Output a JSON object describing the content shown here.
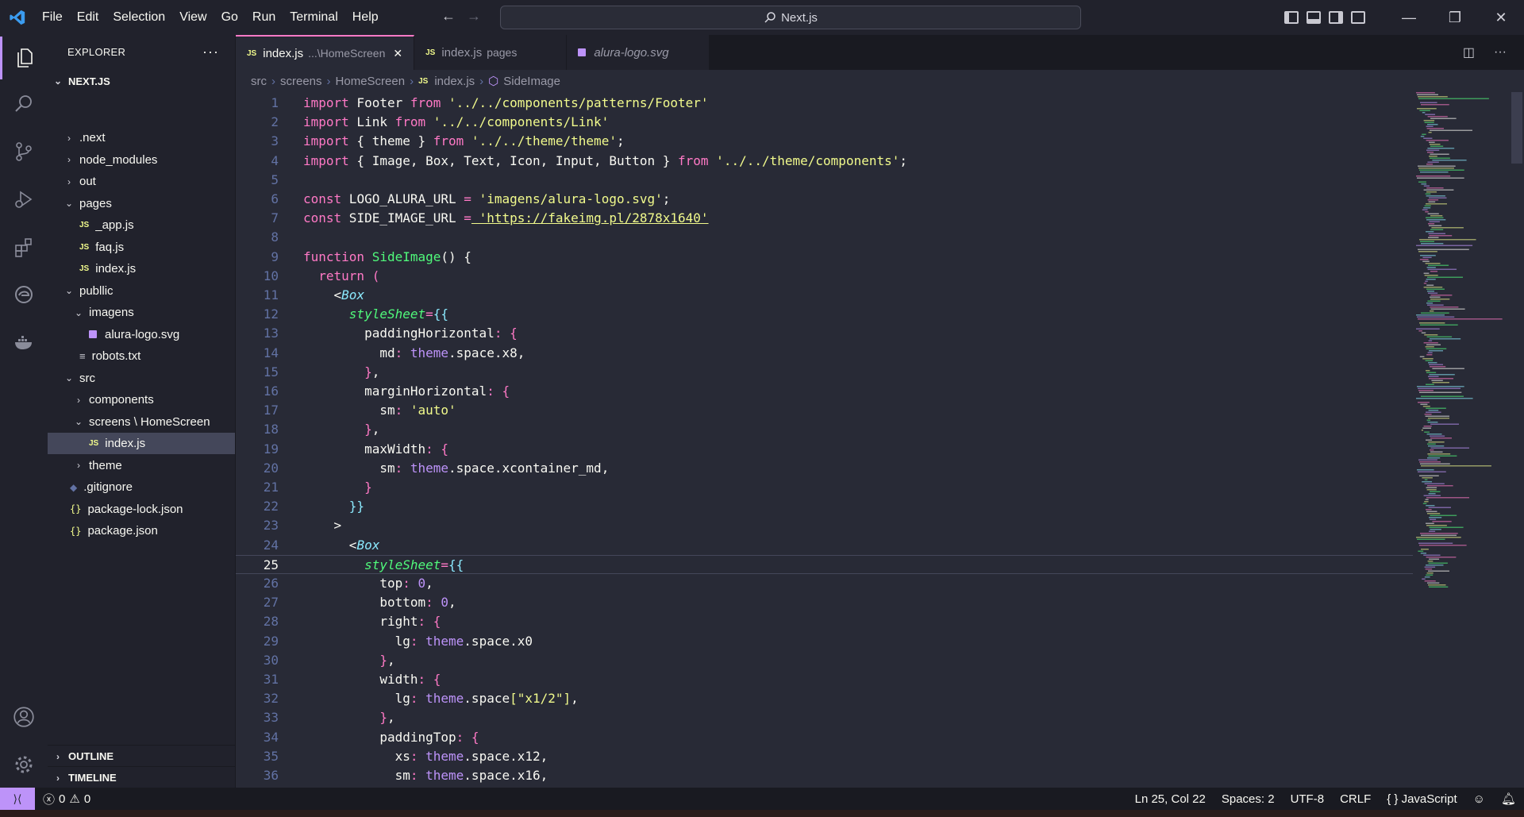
{
  "menu": [
    "File",
    "Edit",
    "Selection",
    "View",
    "Go",
    "Run",
    "Terminal",
    "Help"
  ],
  "command_center": "Next.js",
  "sidebar": {
    "title": "EXPLORER",
    "project": "NEXT.JS",
    "tree": [
      {
        "label": ".next",
        "type": "folder",
        "open": false,
        "depth": 1
      },
      {
        "label": "node_modules",
        "type": "folder",
        "open": false,
        "depth": 1
      },
      {
        "label": "out",
        "type": "folder",
        "open": false,
        "depth": 1
      },
      {
        "label": "pages",
        "type": "folder",
        "open": true,
        "depth": 1
      },
      {
        "label": "_app.js",
        "type": "js",
        "depth": 2
      },
      {
        "label": "faq.js",
        "type": "js",
        "depth": 2
      },
      {
        "label": "index.js",
        "type": "js",
        "depth": 2
      },
      {
        "label": "publlic",
        "type": "folder",
        "open": true,
        "depth": 1
      },
      {
        "label": "imagens",
        "type": "folder",
        "open": true,
        "depth": 2
      },
      {
        "label": "alura-logo.svg",
        "type": "svg",
        "depth": 3
      },
      {
        "label": "robots.txt",
        "type": "txt",
        "depth": 2
      },
      {
        "label": "src",
        "type": "folder",
        "open": true,
        "depth": 1
      },
      {
        "label": "components",
        "type": "folder",
        "open": false,
        "depth": 2
      },
      {
        "label": "screens \\ HomeScreen",
        "type": "folder",
        "open": true,
        "depth": 2
      },
      {
        "label": "index.js",
        "type": "js",
        "depth": 3,
        "selected": true
      },
      {
        "label": "theme",
        "type": "folder",
        "open": false,
        "depth": 2
      },
      {
        "label": ".gitignore",
        "type": "git",
        "depth": 1
      },
      {
        "label": "package-lock.json",
        "type": "json",
        "depth": 1
      },
      {
        "label": "package.json",
        "type": "json",
        "depth": 1
      }
    ],
    "outline": "OUTLINE",
    "timeline": "TIMELINE"
  },
  "tabs": [
    {
      "label": "index.js",
      "desc": "...\\HomeScreen",
      "active": true
    },
    {
      "label": "index.js",
      "desc": "pages",
      "active": false
    },
    {
      "label": "alura-logo.svg",
      "desc": "",
      "active": false
    }
  ],
  "breadcrumb": [
    "src",
    "screens",
    "HomeScreen",
    "index.js",
    "SideImage"
  ],
  "status": {
    "errors": "0",
    "warnings": "0",
    "position": "Ln 25, Col 22",
    "spaces": "Spaces: 2",
    "encoding": "UTF-8",
    "eol": "CRLF",
    "language": "JavaScript"
  },
  "colors": {
    "accent": "#bd93f9",
    "tab_border": "#ff79c6",
    "bg": "#282a36",
    "sidebar": "#21222c"
  },
  "current_line": 25,
  "code": [
    [
      [
        "kw",
        "import"
      ],
      [
        "pun",
        " Footer "
      ],
      [
        "kw",
        "from"
      ],
      [
        "str",
        " '../../components/patterns/Footer'"
      ]
    ],
    [
      [
        "kw",
        "import"
      ],
      [
        "pun",
        " Link "
      ],
      [
        "kw",
        "from"
      ],
      [
        "str",
        " '../../components/Link'"
      ]
    ],
    [
      [
        "kw",
        "import"
      ],
      [
        "pun",
        " { theme } "
      ],
      [
        "kw",
        "from"
      ],
      [
        "str",
        " '../../theme/theme'"
      ],
      [
        "pun",
        ";"
      ]
    ],
    [
      [
        "kw",
        "import"
      ],
      [
        "pun",
        " { Image, Box, Text, Icon, Input, Button } "
      ],
      [
        "kw",
        "from"
      ],
      [
        "str",
        " '../../theme/components'"
      ],
      [
        "pun",
        ";"
      ]
    ],
    [],
    [
      [
        "kw",
        "const"
      ],
      [
        "pun",
        " LOGO_ALURA_URL "
      ],
      [
        "kw",
        "="
      ],
      [
        "str",
        " 'imagens/alura-logo.svg'"
      ],
      [
        "pun",
        ";"
      ]
    ],
    [
      [
        "kw",
        "const"
      ],
      [
        "pun",
        " SIDE_IMAGE_URL "
      ],
      [
        "kw",
        "="
      ],
      [
        "str",
        " 'https://fakeimg.pl/2878x1640'"
      ]
    ],
    [],
    [
      [
        "kw",
        "function"
      ],
      [
        "fn",
        " SideImage"
      ],
      [
        "pun",
        "() {"
      ]
    ],
    [
      [
        "pun",
        "  "
      ],
      [
        "kw",
        "return"
      ],
      [
        "br2",
        " ("
      ]
    ],
    [
      [
        "pun",
        "    <"
      ],
      [
        "comp",
        "Box"
      ]
    ],
    [
      [
        "pun",
        "      "
      ],
      [
        "attr",
        "styleSheet"
      ],
      [
        "kw",
        "="
      ],
      [
        "br3",
        "{{"
      ]
    ],
    [
      [
        "pun",
        "        paddingHorizontal"
      ],
      [
        "kw",
        ":"
      ],
      [
        "br2",
        " {"
      ]
    ],
    [
      [
        "pun",
        "          md"
      ],
      [
        "kw",
        ":"
      ],
      [
        "th",
        " theme"
      ],
      [
        "pun",
        ".space.x8,"
      ]
    ],
    [
      [
        "br2",
        "        }"
      ],
      [
        "pun",
        ","
      ]
    ],
    [
      [
        "pun",
        "        marginHorizontal"
      ],
      [
        "kw",
        ":"
      ],
      [
        "br2",
        " {"
      ]
    ],
    [
      [
        "pun",
        "          sm"
      ],
      [
        "kw",
        ":"
      ],
      [
        "str",
        " 'auto'"
      ]
    ],
    [
      [
        "br2",
        "        }"
      ],
      [
        "pun",
        ","
      ]
    ],
    [
      [
        "pun",
        "        maxWidth"
      ],
      [
        "kw",
        ":"
      ],
      [
        "br2",
        " {"
      ]
    ],
    [
      [
        "pun",
        "          sm"
      ],
      [
        "kw",
        ":"
      ],
      [
        "th",
        " theme"
      ],
      [
        "pun",
        ".space.xcontainer_md,"
      ]
    ],
    [
      [
        "br2",
        "        }"
      ]
    ],
    [
      [
        "br3",
        "      }}"
      ]
    ],
    [
      [
        "pun",
        "    >"
      ]
    ],
    [
      [
        "pun",
        "      <"
      ],
      [
        "comp",
        "Box"
      ]
    ],
    [
      [
        "pun",
        "        "
      ],
      [
        "attr",
        "styleSheet"
      ],
      [
        "kw",
        "="
      ],
      [
        "br3",
        "{{"
      ]
    ],
    [
      [
        "pun",
        "          top"
      ],
      [
        "kw",
        ":"
      ],
      [
        "num",
        " 0"
      ],
      [
        "pun",
        ","
      ]
    ],
    [
      [
        "pun",
        "          bottom"
      ],
      [
        "kw",
        ":"
      ],
      [
        "num",
        " 0"
      ],
      [
        "pun",
        ","
      ]
    ],
    [
      [
        "pun",
        "          right"
      ],
      [
        "kw",
        ":"
      ],
      [
        "br2",
        " {"
      ]
    ],
    [
      [
        "pun",
        "            lg"
      ],
      [
        "kw",
        ":"
      ],
      [
        "th",
        " theme"
      ],
      [
        "pun",
        ".space.x0"
      ]
    ],
    [
      [
        "br2",
        "          }"
      ],
      [
        "pun",
        ","
      ]
    ],
    [
      [
        "pun",
        "          width"
      ],
      [
        "kw",
        ":"
      ],
      [
        "br2",
        " {"
      ]
    ],
    [
      [
        "pun",
        "            lg"
      ],
      [
        "kw",
        ":"
      ],
      [
        "th",
        " theme"
      ],
      [
        "pun",
        ".space"
      ],
      [
        "br1",
        "["
      ],
      [
        "str",
        "\"x1/2\""
      ],
      [
        "br1",
        "]"
      ],
      [
        "pun",
        ","
      ]
    ],
    [
      [
        "br2",
        "          }"
      ],
      [
        "pun",
        ","
      ]
    ],
    [
      [
        "pun",
        "          paddingTop"
      ],
      [
        "kw",
        ":"
      ],
      [
        "br2",
        " {"
      ]
    ],
    [
      [
        "pun",
        "            xs"
      ],
      [
        "kw",
        ":"
      ],
      [
        "th",
        " theme"
      ],
      [
        "pun",
        ".space.x12,"
      ]
    ],
    [
      [
        "pun",
        "            sm"
      ],
      [
        "kw",
        ":"
      ],
      [
        "th",
        " theme"
      ],
      [
        "pun",
        ".space.x16,"
      ]
    ],
    [
      [
        "br2",
        "          }"
      ],
      [
        "pun",
        ","
      ]
    ]
  ]
}
